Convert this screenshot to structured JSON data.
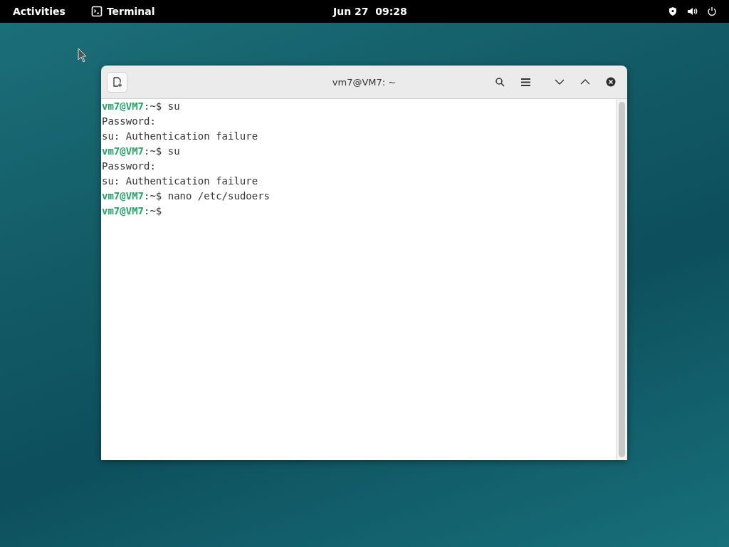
{
  "top_bar": {
    "activities": "Activities",
    "app": "Terminal",
    "clock": "Jun 27  09:28"
  },
  "window": {
    "title": "vm7@VM7: ~"
  },
  "terminal": {
    "lines": [
      {
        "kind": "prompt",
        "user": "vm7@VM7",
        "rest": ":~$ su"
      },
      {
        "kind": "output",
        "text": "Password:"
      },
      {
        "kind": "output",
        "text": "su: Authentication failure"
      },
      {
        "kind": "prompt",
        "user": "vm7@VM7",
        "rest": ":~$ su"
      },
      {
        "kind": "output",
        "text": "Password:"
      },
      {
        "kind": "output",
        "text": "su: Authentication failure"
      },
      {
        "kind": "prompt",
        "user": "vm7@VM7",
        "rest": ":~$ nano /etc/sudoers"
      },
      {
        "kind": "prompt",
        "user": "vm7@VM7",
        "rest": ":~$"
      }
    ]
  }
}
